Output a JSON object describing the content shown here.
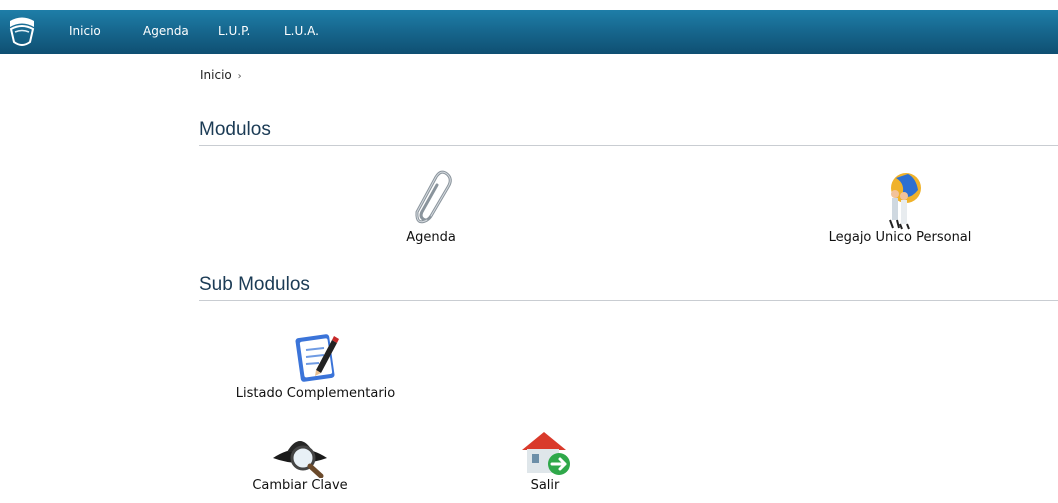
{
  "nav": {
    "logo_icon": "ribbon-logo-icon",
    "items": [
      {
        "label": "Inicio"
      },
      {
        "label": "Agenda"
      },
      {
        "label": "L.U.P."
      },
      {
        "label": "L.U.A."
      }
    ]
  },
  "breadcrumb": {
    "current": "Inicio",
    "separator": "›"
  },
  "modules": {
    "title": "Modulos",
    "items": [
      {
        "label": "Agenda",
        "icon": "paperclip-icon"
      },
      {
        "label": "Legajo Unico Personal",
        "icon": "people-globe-icon"
      }
    ]
  },
  "submodules": {
    "title": "Sub Modulos",
    "items": [
      {
        "label": "Listado Complementario",
        "icon": "notepad-pen-icon"
      },
      {
        "label": "Cambiar Clave",
        "icon": "detective-magnifier-icon"
      },
      {
        "label": "Salir",
        "icon": "house-exit-icon"
      }
    ]
  },
  "colors": {
    "topbar": "#17688f",
    "section_title": "#1b3b55"
  }
}
